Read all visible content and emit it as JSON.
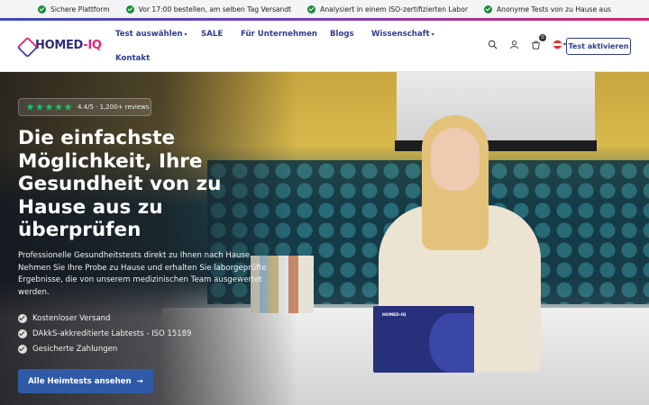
{
  "announcement": {
    "items": [
      "Sichere Plattform",
      "Vor 17:00 bestellen, am selben Tag Versandt",
      "Analysiert in einem ISO-zertifizierten Labor",
      "Anonyme Tests von zu Hause aus"
    ]
  },
  "header": {
    "logo_main": "HOMED",
    "logo_dash": "-",
    "logo_iq": "IQ",
    "nav": [
      {
        "label": "Test auswählen",
        "has_caret": true
      },
      {
        "label": "SALE",
        "has_caret": false
      },
      {
        "label": "Für Unternehmen",
        "has_caret": false
      },
      {
        "label": "Blogs",
        "has_caret": false
      },
      {
        "label": "Wissenschaft",
        "has_caret": true
      },
      {
        "label": "Kontakt",
        "has_caret": false
      }
    ],
    "cart_count": "0",
    "cta_label": "Test aktivieren"
  },
  "hero": {
    "rating_text": "4.4/5 · 1,200+ reviews",
    "stars": 5,
    "headline": "Die einfachste Möglichkeit, Ihre Gesundheit von zu Hause aus zu überprüfen",
    "lede": "Professionelle Gesundheitstests direkt zu Ihnen nach Hause. Nehmen Sie Ihre Probe zu Hause und erhalten Sie laborgeprüfte Ergebnisse, die von unserem medizinischen Team ausgewertet werden.",
    "features": [
      "Kostenloser Versand",
      "DAkkS-akkreditierte Labtests - ISO 15189",
      "Gesicherte Zahlungen"
    ],
    "button_label": "Alle Heimtests ansehen",
    "button_arrow": "→",
    "box_brand": "HOMED-IQ"
  },
  "colors": {
    "brand_navy": "#2f3c8f",
    "brand_pink": "#e0267a",
    "check_green": "#1d8a3a",
    "star_green": "#1fbf6a",
    "button_blue": "#2f5aa8"
  }
}
